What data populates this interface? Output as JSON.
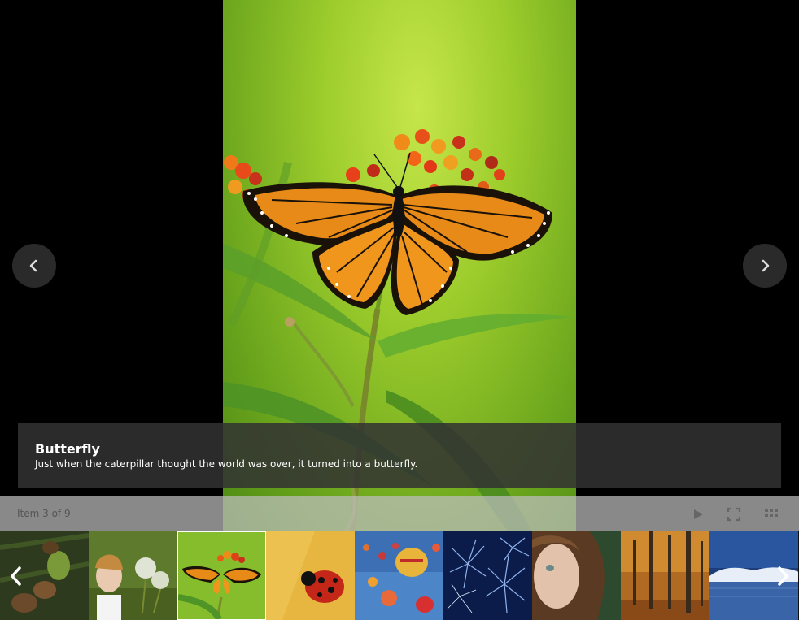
{
  "viewer": {
    "current_image": {
      "name": "Butterfly",
      "description": "Just when the caterpillar thought the world was over, it turned into a butterfly."
    },
    "prev_icon": "chevron-left-icon",
    "next_icon": "chevron-right-icon"
  },
  "toolbar": {
    "counter": "Item 3 of 9",
    "icons": [
      "play-icon",
      "fullscreen-icon",
      "grid-icon"
    ]
  },
  "thumbnails": [
    {
      "subject": "pine cones",
      "active": false
    },
    {
      "subject": "girl with dandelions",
      "active": false
    },
    {
      "subject": "butterfly",
      "active": true
    },
    {
      "subject": "ladybug",
      "active": false
    },
    {
      "subject": "hot air balloons",
      "active": false
    },
    {
      "subject": "fireworks",
      "active": false
    },
    {
      "subject": "child portrait",
      "active": false
    },
    {
      "subject": "autumn forest",
      "active": false
    },
    {
      "subject": "winter lake",
      "active": false
    }
  ],
  "colors": {
    "background": "#000000",
    "caption_bg": "#323232",
    "toolbar_bg": "#bebebe",
    "nav_button_bg": "#2a2a2a"
  }
}
